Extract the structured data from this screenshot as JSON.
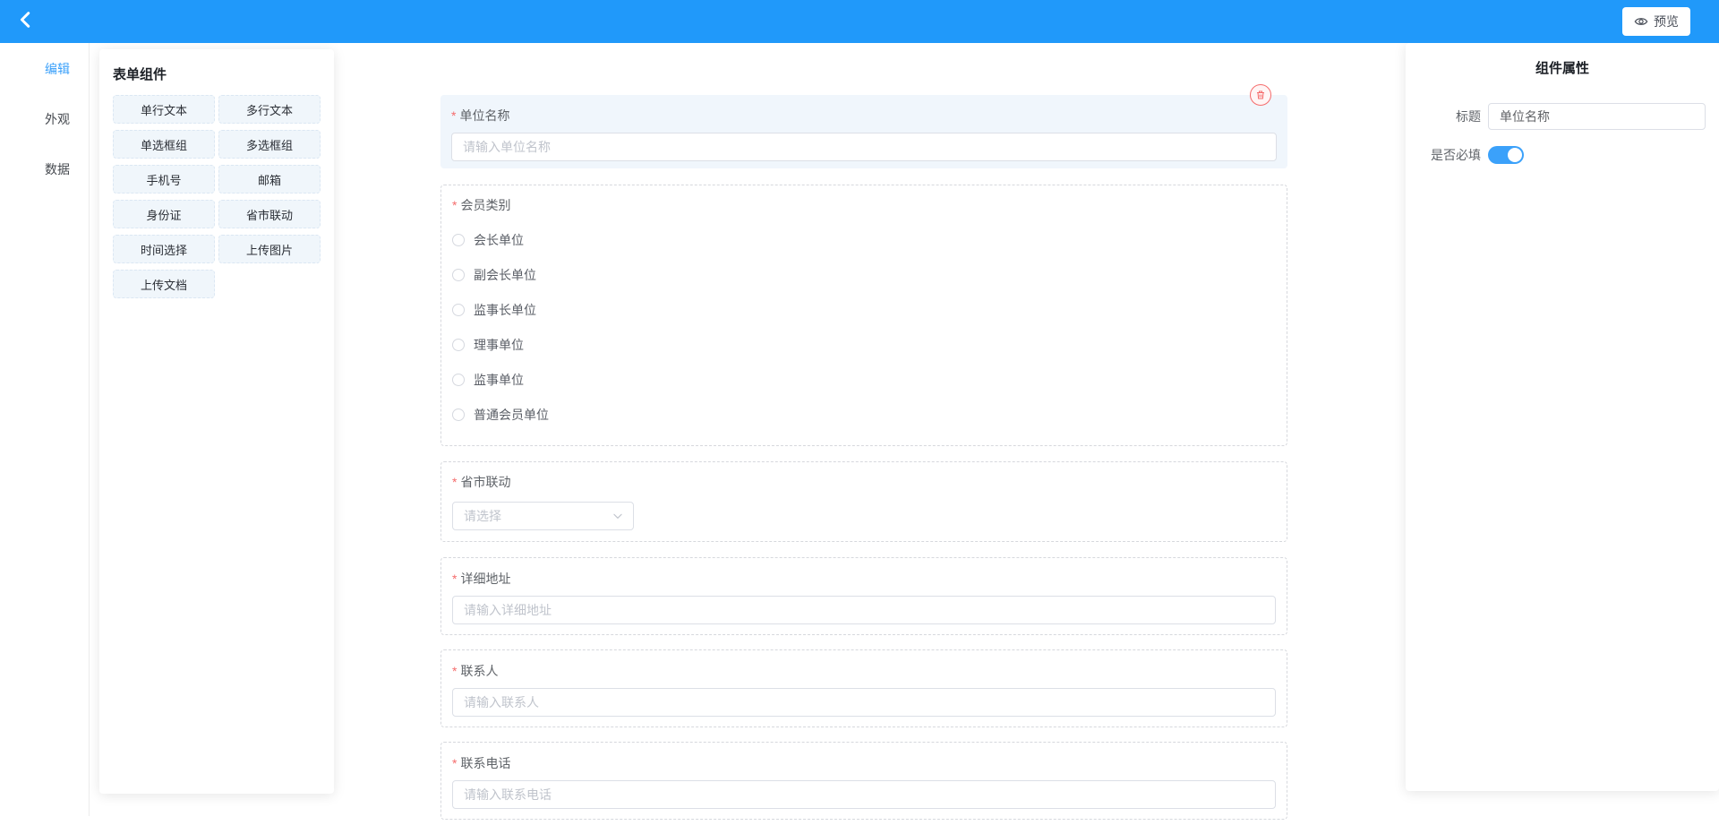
{
  "header": {
    "preview_label": "预览"
  },
  "sidebar": {
    "tabs": [
      {
        "label": "编辑",
        "active": true
      },
      {
        "label": "外观",
        "active": false
      },
      {
        "label": "数据",
        "active": false
      }
    ]
  },
  "components_panel": {
    "title": "表单组件",
    "items": [
      "单行文本",
      "多行文本",
      "单选框组",
      "多选框组",
      "手机号",
      "邮箱",
      "身份证",
      "省市联动",
      "时间选择",
      "上传图片",
      "上传文档"
    ]
  },
  "required_marker": "*",
  "canvas": {
    "fields": [
      {
        "type": "input",
        "label": "单位名称",
        "required": true,
        "placeholder": "请输入单位名称",
        "selected": true
      },
      {
        "type": "radio-group",
        "label": "会员类别",
        "required": true,
        "options": [
          "会长单位",
          "副会长单位",
          "监事长单位",
          "理事单位",
          "监事单位",
          "普通会员单位"
        ]
      },
      {
        "type": "select",
        "label": "省市联动",
        "required": true,
        "placeholder": "请选择"
      },
      {
        "type": "input",
        "label": "详细地址",
        "required": true,
        "placeholder": "请输入详细地址"
      },
      {
        "type": "input",
        "label": "联系人",
        "required": true,
        "placeholder": "请输入联系人"
      },
      {
        "type": "input",
        "label": "联系电话",
        "required": true,
        "placeholder": "请输入联系电话"
      }
    ]
  },
  "properties_panel": {
    "title": "组件属性",
    "title_field": {
      "label": "标题",
      "value": "单位名称"
    },
    "required_field": {
      "label": "是否必填",
      "on": true
    }
  },
  "colors": {
    "header_blue": "#2099fa",
    "accent_blue": "#3aa1fa",
    "danger_red": "#f56c6c",
    "component_button_bg": "#f0f6fb",
    "selected_card_bg": "#f0f6fc",
    "placeholder_gray": "#c0c4cc"
  }
}
